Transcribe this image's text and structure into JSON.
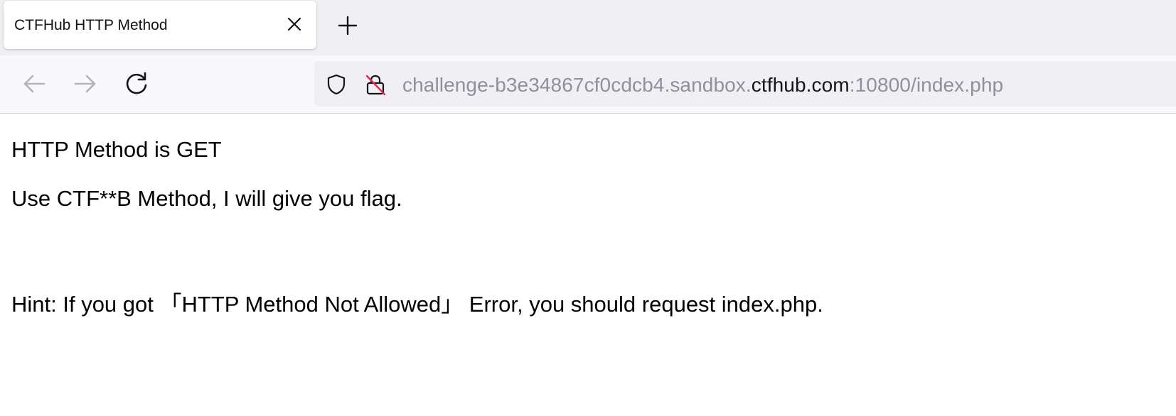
{
  "browser": {
    "tab": {
      "title": "CTFHub HTTP Method",
      "close_icon": "close-icon"
    },
    "new_tab_icon": "plus-icon",
    "nav": {
      "back_icon": "arrow-left-icon",
      "forward_icon": "arrow-right-icon",
      "reload_icon": "reload-icon"
    },
    "url": {
      "prefix": "challenge-b3e34867cf0cdcb4.sandbox.",
      "domain": "ctfhub.com",
      "suffix": ":10800/index.php",
      "shield_icon": "shield-icon",
      "insecure_lock_icon": "insecure-lock-icon"
    }
  },
  "page": {
    "line1": "HTTP Method is GET",
    "line2": "Use CTF**B Method, I will give you flag.",
    "hint": "Hint: If you got 「HTTP Method Not Allowed」 Error, you should request index.php."
  },
  "colors": {
    "tabbar_bg": "#f0f0f4",
    "navbar_bg": "#f9f9fb",
    "urlbar_bg": "#f0f0f4",
    "url_muted": "#8f8f9d",
    "url_domain": "#15141a",
    "insecure_slash": "#e22850"
  }
}
